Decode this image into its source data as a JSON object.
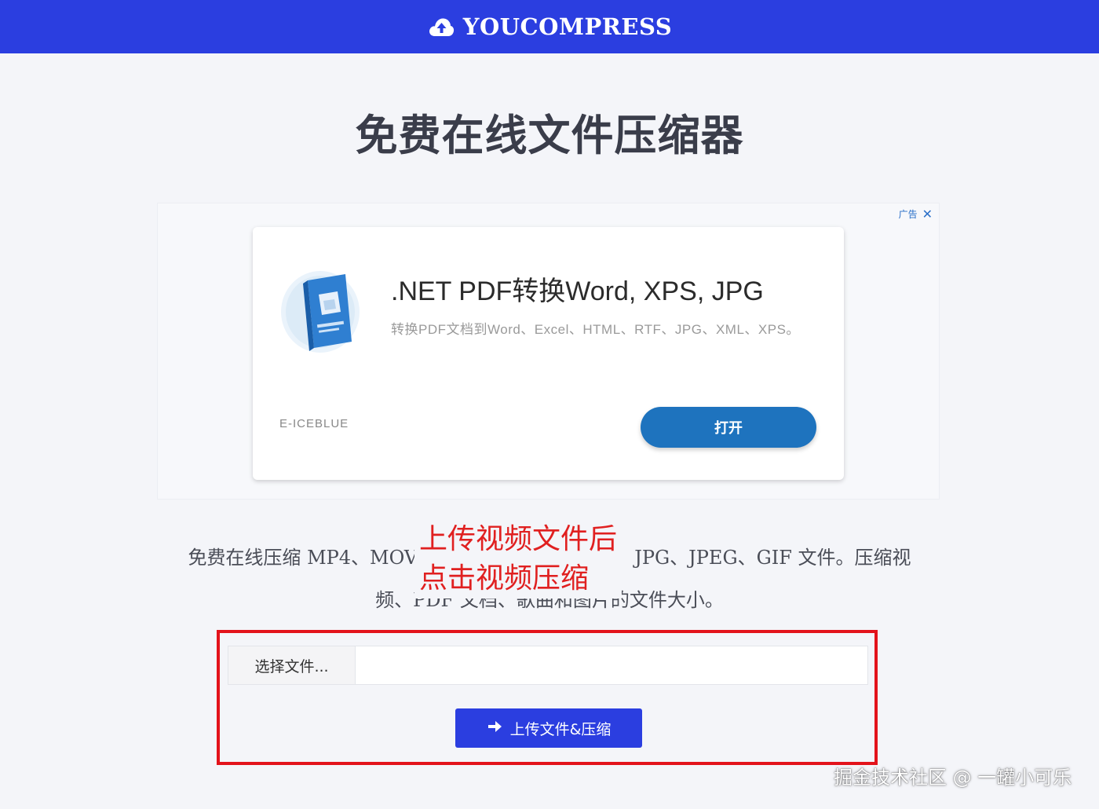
{
  "header": {
    "brand": "YOUCOMPRESS",
    "logo_icon": "cloud-upload-icon",
    "background": "#2b3ee0"
  },
  "page_title": "免费在线文件压缩器",
  "ad": {
    "label": "广告",
    "close_icon": "close-icon",
    "headline": ".NET PDF转换Word, XPS, JPG",
    "description": "转换PDF文档到Word、Excel、HTML、RTF、JPG、XML、XPS。",
    "advertiser": "E-ICEBLUE",
    "open_button": "打开",
    "button_color": "#1e73be"
  },
  "description": {
    "line1_left": "免费在线压缩 MP4、MOV",
    "line1_right": "JPG、JPEG、GIF 文件。压缩视",
    "line2": "频、PDF 文档、歌曲和图片的文件大小。"
  },
  "annotation": {
    "line1": "上传视频文件后",
    "line2": "点击视频压缩",
    "color": "#e02020"
  },
  "upload_form": {
    "choose_file_label": "选择文件...",
    "file_value": "",
    "submit_label": "上传文件&压缩",
    "submit_icon": "arrow-right-icon"
  },
  "watermark": "掘金技术社区 @ 一罐小可乐"
}
